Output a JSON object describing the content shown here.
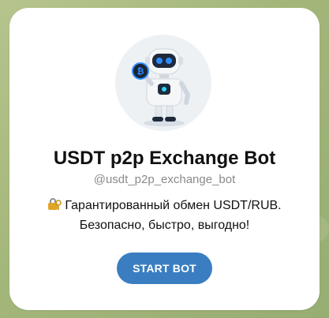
{
  "bot": {
    "name": "USDT p2p Exchange Bot",
    "username": "@usdt_p2p_exchange_bot",
    "description_line1": "Гарантированный обмен USDT/RUB.",
    "description_line2": "Безопасно, быстро, выгодно!",
    "description_icon": "lock-icon",
    "avatar_icon": "robot-icon",
    "coin_icon": "bitcoin-coin-icon"
  },
  "actions": {
    "start_label": "START BOT"
  },
  "colors": {
    "button": "#3a7ec1",
    "card": "#ffffff",
    "wallpaper": "#9fb07a"
  }
}
